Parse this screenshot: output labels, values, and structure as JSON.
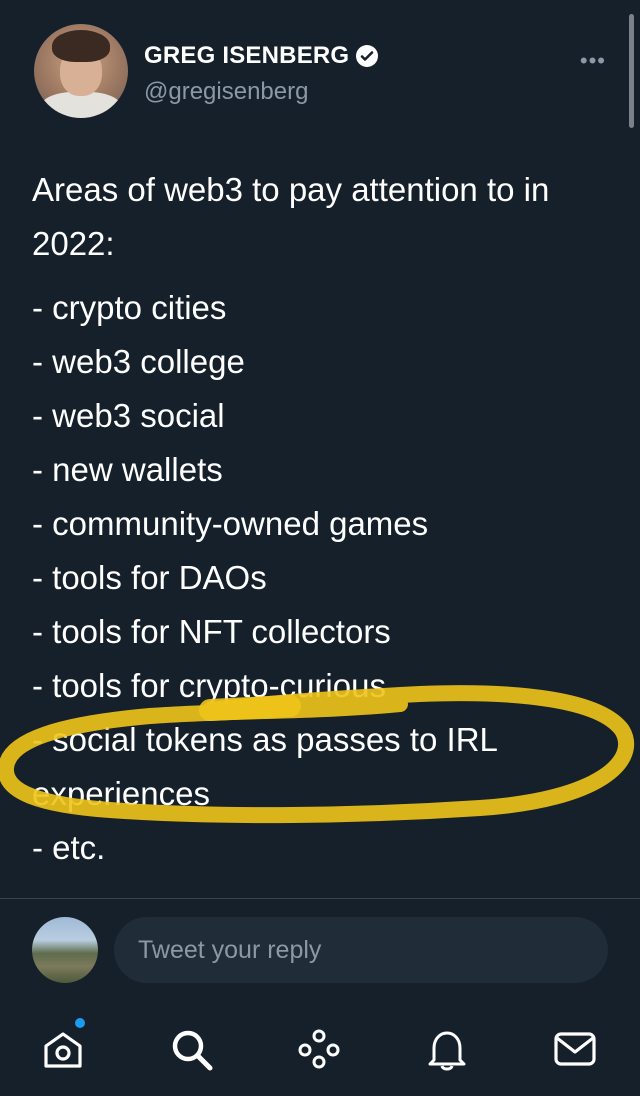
{
  "tweet": {
    "author_name": "GREG ISENBERG",
    "handle": "@gregisenberg",
    "more_label": "•••",
    "intro": "Areas of web3 to pay attention to in 2022:",
    "items": [
      "- crypto cities",
      "- web3 college",
      "- web3 social",
      "- new wallets",
      "- community-owned games",
      "- tools for DAOs",
      "- tools for NFT collectors",
      "- tools for crypto-curious",
      "- social tokens as passes to IRL experiences",
      "- etc."
    ]
  },
  "reply": {
    "placeholder": "Tweet your reply"
  },
  "nav": {
    "icons": [
      "home-icon",
      "search-icon",
      "spaces-icon",
      "notifications-icon",
      "messages-icon"
    ],
    "home_has_badge": true
  },
  "colors": {
    "background": "#15202b",
    "muted_text": "#8b98a5",
    "highlight": "#f0c419",
    "accent": "#1d9bf0"
  }
}
